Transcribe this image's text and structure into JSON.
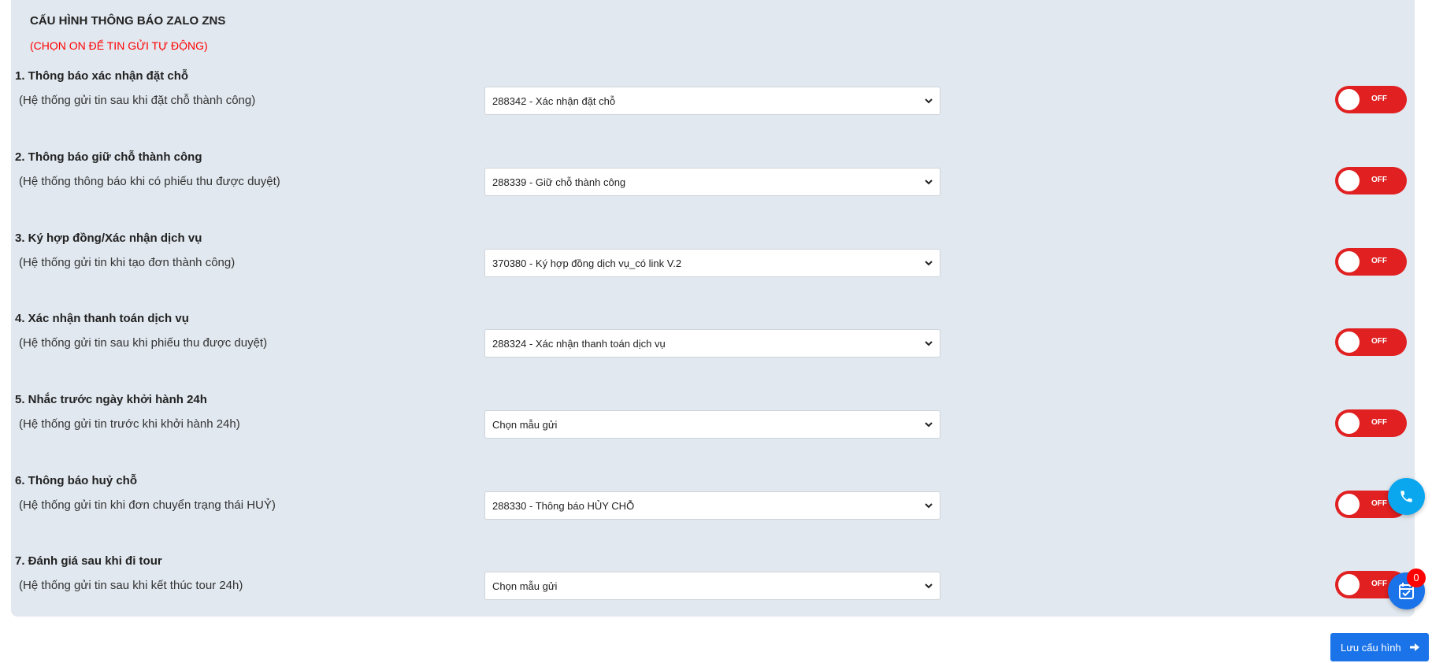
{
  "header": {
    "title": "CẤU HÌNH THÔNG BÁO ZALO ZNS",
    "subtitle": "(CHỌN ON ĐỂ TIN GỬI TỰ ĐỘNG)"
  },
  "rows": [
    {
      "heading": "1. Thông báo xác nhận đặt chỗ",
      "desc": "(Hệ thống gửi tin sau khi đặt chỗ thành công)",
      "template": "288342 - Xác nhận đặt chỗ",
      "toggle": "OFF"
    },
    {
      "heading": "2. Thông báo giữ chỗ thành công",
      "desc": "(Hệ thống thông báo khi có phiếu thu được duyệt)",
      "template": "288339 - Giữ chỗ thành công",
      "toggle": "OFF"
    },
    {
      "heading": "3. Ký hợp đồng/Xác nhận dịch vụ",
      "desc": "(Hệ thống gửi tin khi tạo đơn thành công)",
      "template": "370380 - Ký hợp đồng dịch vụ_có link V.2",
      "toggle": "OFF"
    },
    {
      "heading": "4. Xác nhận thanh toán dịch vụ",
      "desc": "(Hệ thống gửi tin sau khi phiếu thu được duyệt)",
      "template": "288324 - Xác nhận thanh toán dịch vụ",
      "toggle": "OFF"
    },
    {
      "heading": "5. Nhắc trước ngày khởi hành 24h",
      "desc": "(Hệ thống gửi tin trước khi khởi hành 24h)",
      "template": "Chọn mẫu gửi",
      "toggle": "OFF"
    },
    {
      "heading": "6. Thông báo huỷ chỗ",
      "desc": "(Hệ thống gửi tin khi đơn chuyển trạng thái HUỶ)",
      "template": "288330 - Thông báo HỦY CHỖ",
      "toggle": "OFF"
    },
    {
      "heading": "7. Đánh giá sau khi đi tour",
      "desc": "(Hệ thống gửi tin sau khi kết thúc tour 24h)",
      "template": "Chọn mẫu gửi",
      "toggle": "OFF"
    }
  ],
  "widgets": {
    "phone_icon": "phone-icon",
    "calendar_icon": "calendar-check-icon",
    "badge_count": "0"
  },
  "footer": {
    "save_label": "Lưu cấu hình"
  },
  "colors": {
    "panel_bg": "#e1e8ef",
    "toggle_off": "#e02021",
    "accent": "#1a73e8",
    "subtitle": "#ff0000"
  }
}
